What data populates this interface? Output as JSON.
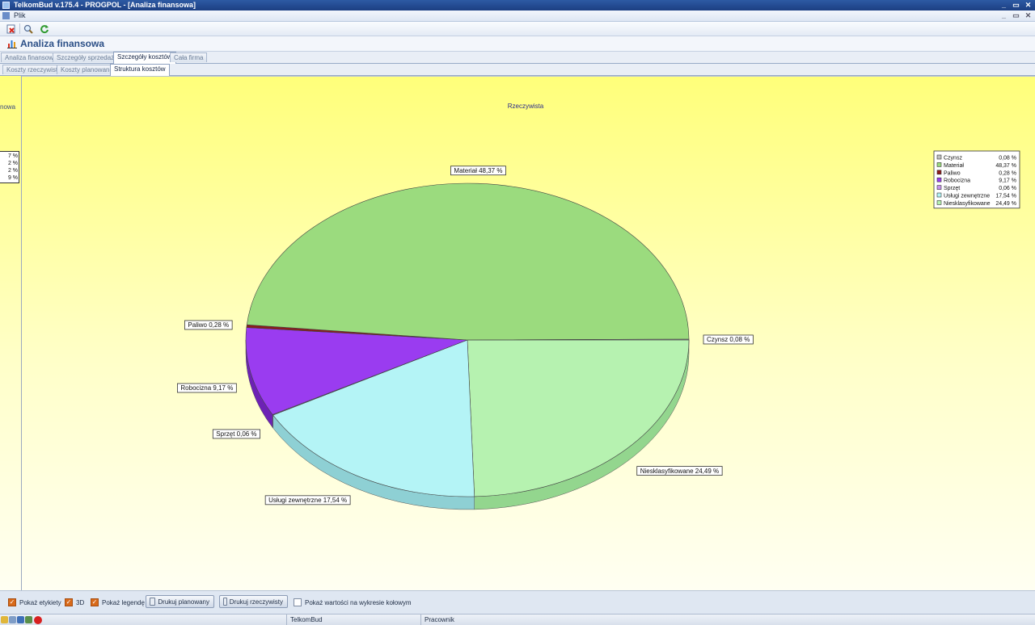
{
  "window": {
    "title": "TelkomBud v.175.4 - PROGPOL - [Analiza finansowa]",
    "buttons": [
      "_",
      "▭",
      "✕"
    ]
  },
  "menu": {
    "items": [
      "Plik"
    ],
    "buttons": [
      "_",
      "▭",
      "✕"
    ]
  },
  "toolbar": {
    "buttons": [
      "close-document-icon",
      "search-icon",
      "refresh-icon"
    ]
  },
  "header": {
    "title": "Analiza finansowa"
  },
  "tabs_main": [
    {
      "label": "Analiza finansowa",
      "active": false
    },
    {
      "label": "Szczegóły sprzedaży",
      "active": false
    },
    {
      "label": "Szczegóły kosztów",
      "active": true
    },
    {
      "label": "Cała firma",
      "active": false
    }
  ],
  "tabs_sub": [
    {
      "label": "Koszty rzeczywiste",
      "active": false
    },
    {
      "label": "Koszty planowane",
      "active": false
    },
    {
      "label": "Struktura kosztów",
      "active": true
    }
  ],
  "left_panel": {
    "title_fragment": "nowa",
    "legend_fragments": [
      "7 %",
      "2 %",
      "2 %",
      "9 %"
    ]
  },
  "chart_data": {
    "type": "pie",
    "title": "Rzeczywista",
    "three_d": true,
    "show_labels": true,
    "show_legend": true,
    "legend_placement": "top-right",
    "categories": [
      "Czynsz",
      "Materiał",
      "Paliwo",
      "Robocizna",
      "Sprzęt",
      "Usługi zewnętrzne",
      "Niesklasyfikowane"
    ],
    "values": [
      0.08,
      48.37,
      0.28,
      9.17,
      0.06,
      17.54,
      24.49
    ],
    "value_labels": [
      "0,08 %",
      "48,37 %",
      "0,28 %",
      "9,17 %",
      "0,06 %",
      "17,54 %",
      "24,49 %"
    ],
    "slice_labels": [
      "Czynsz 0,08 %",
      "Materiał 48,37 %",
      "Paliwo 0,28 %",
      "Robocizna 9,17 %",
      "Sprzęt 0,06 %",
      "Usługi zewnętrzne 17,54 %",
      "Niesklasyfikowane 24,49 %"
    ],
    "colors": [
      "#c0c0c0",
      "#9bdb7e",
      "#8c1c1c",
      "#9a3cf0",
      "#c792ee",
      "#b4f4f6",
      "#b6f2b0"
    ],
    "side_colors": [
      "#9a9a9a",
      "#7fbf66",
      "#5c1010",
      "#6d21b5",
      "#a070cc",
      "#8ed0d4",
      "#93d68e"
    ]
  },
  "bottom": {
    "show_labels": {
      "label": "Pokaż etykiety",
      "checked": true
    },
    "three_d": {
      "label": "3D",
      "checked": true
    },
    "show_legend": {
      "label": "Pokaż legendę",
      "checked": true
    },
    "print_planned": "Drukuj planowany",
    "print_actual": "Drukuj rzeczywisty",
    "show_values": {
      "label": "Pokaż wartości na wykresie kołowym",
      "checked": false
    }
  },
  "status": {
    "app": "TelkomBud",
    "user": "Pracownik"
  }
}
